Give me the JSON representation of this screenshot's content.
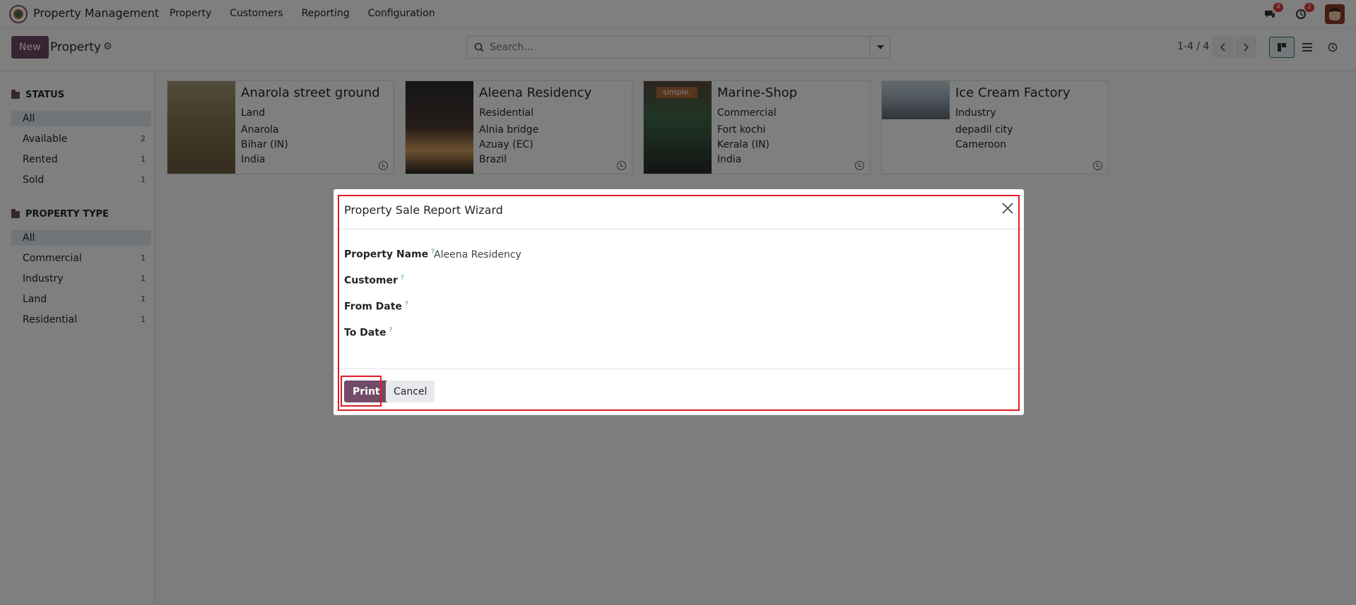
{
  "navbar": {
    "app_title": "Property Management",
    "menu": [
      "Property",
      "Customers",
      "Reporting",
      "Configuration"
    ],
    "messages_badge": "4",
    "activities_badge": "2"
  },
  "control": {
    "new_label": "New",
    "breadcrumb": "Property",
    "search_placeholder": "Search...",
    "pager": "1-4 / 4"
  },
  "sidebar": {
    "status_title": "STATUS",
    "status_items": [
      {
        "label": "All",
        "count": ""
      },
      {
        "label": "Available",
        "count": "2"
      },
      {
        "label": "Rented",
        "count": "1"
      },
      {
        "label": "Sold",
        "count": "1"
      }
    ],
    "type_title": "PROPERTY TYPE",
    "type_items": [
      {
        "label": "All",
        "count": ""
      },
      {
        "label": "Commercial",
        "count": "1"
      },
      {
        "label": "Industry",
        "count": "1"
      },
      {
        "label": "Land",
        "count": "1"
      },
      {
        "label": "Residential",
        "count": "1"
      }
    ]
  },
  "cards": [
    {
      "name": "Anarola street ground",
      "lines": [
        "Land",
        "Anarola",
        "Bihar (IN)",
        "India"
      ]
    },
    {
      "name": "Aleena Residency",
      "lines": [
        "Residential",
        "Alnia bridge",
        "Azuay (EC)",
        "Brazil"
      ]
    },
    {
      "name": "Marine-Shop",
      "lines": [
        "Commercial",
        "Fort kochi",
        "Kerala (IN)",
        "India"
      ],
      "thumb_text": "simple."
    },
    {
      "name": "Ice Cream Factory",
      "lines": [
        "Industry",
        "depadil city",
        "Cameroon"
      ]
    }
  ],
  "modal": {
    "title": "Property Sale Report Wizard",
    "fields": [
      {
        "label": "Property Name",
        "value": "Aleena Residency"
      },
      {
        "label": "Customer",
        "value": ""
      },
      {
        "label": "From Date",
        "value": ""
      },
      {
        "label": "To Date",
        "value": ""
      }
    ],
    "help_mark": "?",
    "print_label": "Print",
    "cancel_label": "Cancel"
  },
  "colors": {
    "brand": "#714b67",
    "highlight": "#e01b24"
  }
}
